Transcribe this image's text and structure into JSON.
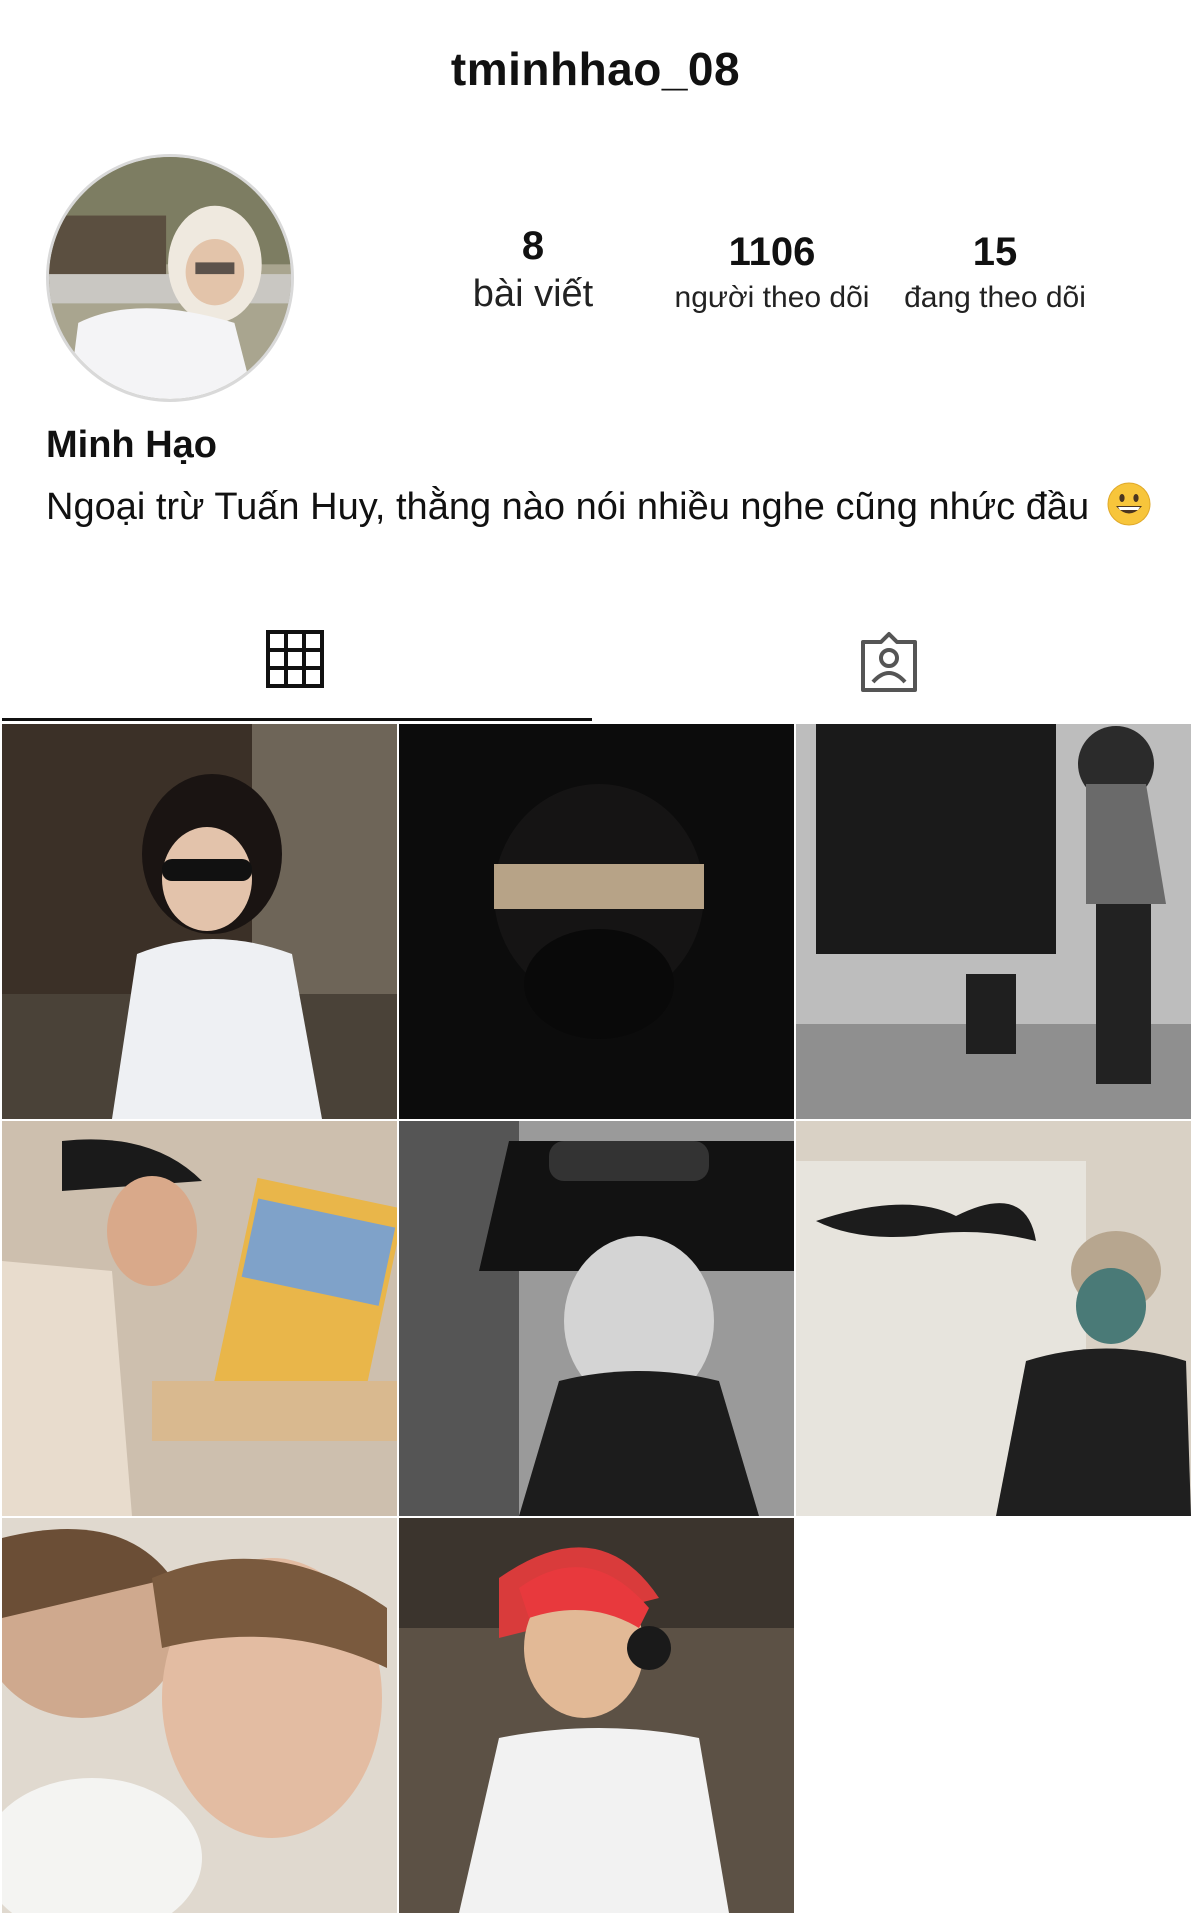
{
  "profile": {
    "username": "tminhhao_08",
    "display_name": "Minh Hạo",
    "bio": "Ngoại trừ Tuấn Huy, thằng nào nói nhiều nghe cũng nhức đầu",
    "bio_emoji": "grinning-face-emoji"
  },
  "stats": {
    "posts": {
      "value": "8",
      "label": "bài viết"
    },
    "followers": {
      "value": "1106",
      "label": "người theo dõi"
    },
    "following": {
      "value": "15",
      "label": "đang theo dõi"
    }
  },
  "tabs": [
    {
      "name": "posts-grid",
      "icon": "grid-icon",
      "active": true
    },
    {
      "name": "tagged",
      "icon": "tagged-person-icon",
      "active": false
    }
  ],
  "posts": [
    {
      "id": 1,
      "description_icon": "photo-thumbnail"
    },
    {
      "id": 2,
      "description_icon": "photo-thumbnail"
    },
    {
      "id": 3,
      "description_icon": "photo-thumbnail"
    },
    {
      "id": 4,
      "description_icon": "photo-thumbnail"
    },
    {
      "id": 5,
      "description_icon": "photo-thumbnail"
    },
    {
      "id": 6,
      "description_icon": "photo-thumbnail"
    },
    {
      "id": 7,
      "description_icon": "photo-thumbnail"
    },
    {
      "id": 8,
      "description_icon": "photo-thumbnail"
    }
  ],
  "colors": {
    "text": "#111111",
    "background": "#ffffff",
    "divider": "#d9d9d9"
  }
}
